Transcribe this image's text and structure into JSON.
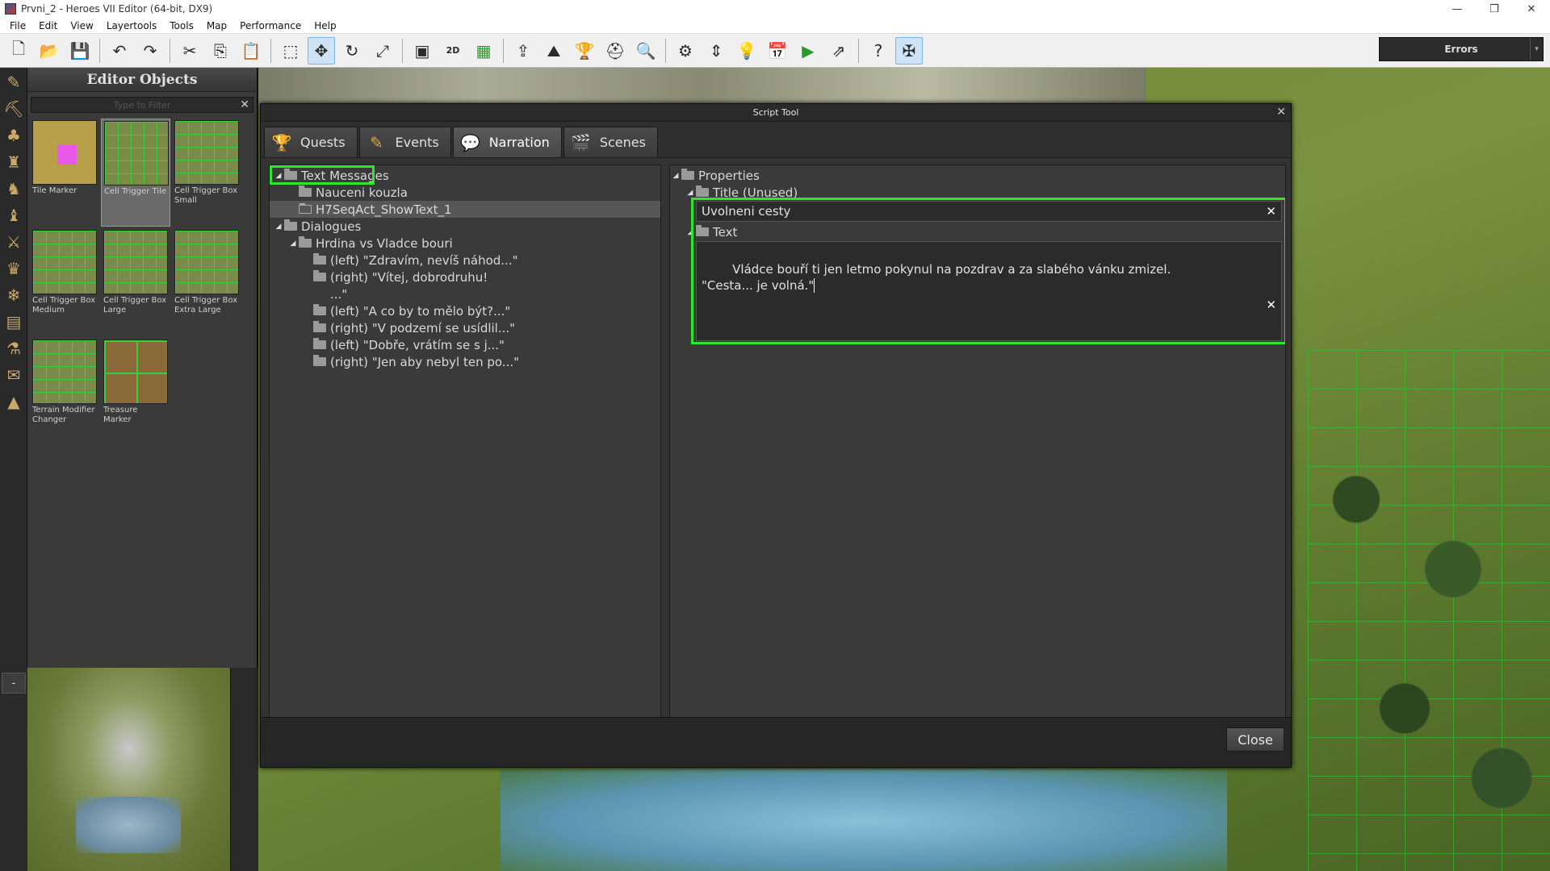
{
  "window": {
    "title": "Prvni_2 - Heroes VII Editor (64-bit, DX9)",
    "controls": [
      "—",
      "❐",
      "✕"
    ]
  },
  "menu": [
    "File",
    "Edit",
    "View",
    "Layertools",
    "Tools",
    "Map",
    "Performance",
    "Help"
  ],
  "toolbar": {
    "icons": [
      "new-icon",
      "open-icon",
      "save-icon",
      "undo-icon",
      "redo-icon",
      "cut-icon",
      "copy-icon",
      "paste-icon",
      "select-icon",
      "move-icon",
      "rotate-icon",
      "scale-icon",
      "screen-icon",
      "2d-icon",
      "grid-icon",
      "upload-icon",
      "terrain-icon",
      "trophy-icon",
      "helmet-icon",
      "search-map-icon",
      "gears-icon",
      "arrows-icon",
      "bulb-icon",
      "calendar-icon",
      "play-icon",
      "export-icon",
      "help-icon",
      "butterfly-icon"
    ],
    "glyphs": [
      "🗋",
      "📂",
      "💾",
      "↶",
      "↷",
      "✂",
      "⎘",
      "📋",
      "⬚",
      "✥",
      "↻",
      "⤢",
      "▣",
      "2D",
      "▦",
      "⇪",
      "⛰",
      "🏆",
      "⛑",
      "🔍",
      "⚙",
      "⇕",
      "💡",
      "📅",
      "▶",
      "⇗",
      "?",
      "✠"
    ],
    "errors_label": "Errors"
  },
  "icon_strip": [
    "brush-icon",
    "pickaxe-icon",
    "tree-icon",
    "castle-icon",
    "hero-icon",
    "knight-icon",
    "army-icon",
    "trophy-icon",
    "crystal-icon",
    "chest-icon",
    "flask-icon",
    "scroll-icon",
    "cone-icon"
  ],
  "icon_strip_glyphs": [
    "✎",
    "⛏",
    "♣",
    "♜",
    "♞",
    "♝",
    "⚔",
    "♛",
    "❄",
    "▤",
    "⚗",
    "✉",
    "▲"
  ],
  "editor_objects": {
    "title": "Editor Objects",
    "filter_placeholder": "Type to Filter",
    "items": [
      {
        "label": "Tile Marker",
        "thumb": "marker",
        "selected": false
      },
      {
        "label": "Cell Trigger Tile",
        "thumb": "grid",
        "selected": true
      },
      {
        "label": "Cell Trigger Box Small",
        "thumb": "grid",
        "selected": false
      },
      {
        "label": "Cell Trigger Box Medium",
        "thumb": "grid",
        "selected": false
      },
      {
        "label": "Cell Trigger Box Large",
        "thumb": "grid",
        "selected": false
      },
      {
        "label": "Cell Trigger Box Extra Large",
        "thumb": "grid",
        "selected": false
      },
      {
        "label": "Terrain Modifier Changer",
        "thumb": "grid",
        "selected": false
      },
      {
        "label": "Treasure Marker",
        "thumb": "treasure",
        "selected": false
      }
    ]
  },
  "minimap": {
    "toggle_label": "-"
  },
  "script_tool": {
    "title": "Script Tool",
    "tabs": [
      {
        "label": "Quests",
        "icon": "quests-icon",
        "glyph": "🏆",
        "color": "#d9b24a",
        "active": false
      },
      {
        "label": "Events",
        "icon": "events-icon",
        "glyph": "✎",
        "color": "#d9a84a",
        "active": false
      },
      {
        "label": "Narration",
        "icon": "narration-icon",
        "glyph": "💬",
        "color": "#7fd0c0",
        "active": true
      },
      {
        "label": "Scenes",
        "icon": "scenes-icon",
        "glyph": "🎬",
        "color": "#c04040",
        "active": false
      }
    ],
    "tree": [
      {
        "label": "Text Messages",
        "level": 0,
        "arrow": "◢",
        "folder": "filled",
        "selected": false
      },
      {
        "label": "Nauceni kouzla",
        "level": 1,
        "arrow": "",
        "folder": "filled",
        "selected": false
      },
      {
        "label": "H7SeqAct_ShowText_1",
        "level": 1,
        "arrow": "",
        "folder": "outline",
        "selected": true
      },
      {
        "label": "Dialogues",
        "level": 0,
        "arrow": "◢",
        "folder": "filled",
        "selected": false
      },
      {
        "label": "Hrdina vs Vladce bouri",
        "level": 1,
        "arrow": "◢",
        "folder": "filled",
        "selected": false
      },
      {
        "label": "(left) \"Zdravím, nevíš náhod...\"",
        "level": 2,
        "arrow": "",
        "folder": "filled",
        "selected": false
      },
      {
        "label": "(right) \"Vítej, dobrodruhu!",
        "level": 2,
        "arrow": "",
        "folder": "filled",
        "selected": false
      },
      {
        "label": "...\"",
        "level": 2,
        "arrow": "",
        "folder": "none",
        "selected": false
      },
      {
        "label": "(left) \"A co by to mělo být?...\"",
        "level": 2,
        "arrow": "",
        "folder": "filled",
        "selected": false
      },
      {
        "label": "(right) \"V podzemí se usídlil...\"",
        "level": 2,
        "arrow": "",
        "folder": "filled",
        "selected": false
      },
      {
        "label": "(left) \"Dobře, vrátím se s j...\"",
        "level": 2,
        "arrow": "",
        "folder": "filled",
        "selected": false
      },
      {
        "label": "(right) \"Jen aby nebyl ten po...\"",
        "level": 2,
        "arrow": "",
        "folder": "filled",
        "selected": false
      }
    ],
    "properties": {
      "root_label": "Properties",
      "title_label": "Title (Unused)",
      "title_value": "Uvolneni cesty",
      "text_label": "Text",
      "text_value": "Vládce bouří ti jen letmo pokynul na pozdrav a za slabého vánku zmizel.\n\"Cesta... je volná.\"",
      "clear_glyph": "✕"
    },
    "close_label": "Close"
  },
  "colors": {
    "highlight": "#2ee62e",
    "dialog_bg": "#2f2f2f",
    "panel_bg": "#3a3a3a"
  }
}
